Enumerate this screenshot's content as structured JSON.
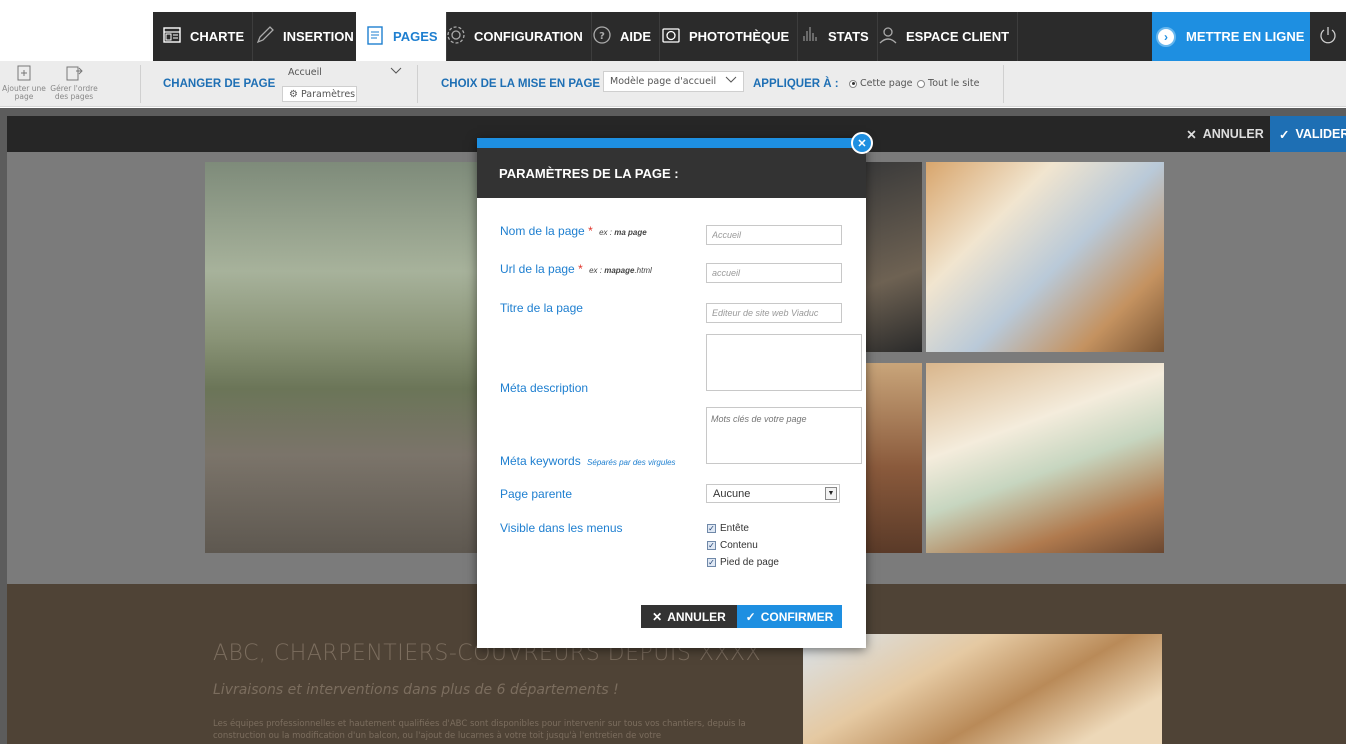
{
  "nav": {
    "items": [
      {
        "label": "CHARTE",
        "icon": "layout-icon"
      },
      {
        "label": "INSERTION",
        "icon": "pencil-icon"
      },
      {
        "label": "PAGES",
        "icon": "pages-icon"
      },
      {
        "label": "CONFIGURATION",
        "icon": "gear-icon"
      },
      {
        "label": "AIDE",
        "icon": "help-icon"
      },
      {
        "label": "PHOTOTHÈQUE",
        "icon": "camera-icon"
      },
      {
        "label": "STATS",
        "icon": "stats-icon"
      },
      {
        "label": "ESPACE CLIENT",
        "icon": "user-icon"
      }
    ],
    "active": "PAGES",
    "publish_label": "METTRE EN LIGNE",
    "accent_color": "#1e8fe1"
  },
  "toolbar": {
    "add_page": "Ajouter une page",
    "order_pages": "Gérer l'ordre des pages",
    "change_page_label": "CHANGER DE PAGE",
    "current_page": "Accueil",
    "params_button": "Paramètres",
    "layout_label": "CHOIX DE LA MISE EN PAGE",
    "layout_value": "Modèle page d'accueil",
    "apply_label": "APPLIQUER À :",
    "apply_options": [
      "Cette page",
      "Tout le site"
    ],
    "apply_selected": "Cette page"
  },
  "editbar": {
    "cancel": "ANNULER",
    "validate": "VALIDER"
  },
  "modal": {
    "title": "PARAMÈTRES DE LA PAGE :",
    "name_label": "Nom de la page",
    "name_hint_prefix": "ex :",
    "name_hint_bold": "ma page",
    "name_placeholder": "Accueil",
    "url_label": "Url de la page",
    "url_hint_prefix": "ex :",
    "url_hint_bold": "mapage",
    "url_hint_suffix": ".html",
    "url_placeholder": "accueil",
    "title_label": "Titre de la page",
    "title_placeholder": "Editeur de site web Viaduc",
    "meta_desc_label": "Méta description",
    "meta_kw_label": "Méta keywords",
    "meta_kw_hint": "Séparés par des virgules",
    "meta_kw_placeholder": "Mots clés de votre page",
    "parent_label": "Page parente",
    "parent_value": "Aucune",
    "visible_label": "Visible dans les menus",
    "visible_options": [
      "Entête",
      "Contenu",
      "Pied de page"
    ],
    "required_mark": "*",
    "cancel": "ANNULER",
    "confirm": "CONFIRMER"
  },
  "site": {
    "heading": "ABC, CHARPENTIERS-COUVREURS DEPUIS XXXX",
    "subheading": "Livraisons et interventions dans plus de 6 départements !",
    "text": "Les équipes professionnelles et hautement qualifiées d'ABC sont disponibles pour intervenir sur tous vos chantiers, depuis la construction ou la modification d'un balcon, ou l'ajout de lucarnes à votre toit jusqu'à l'entretien de votre"
  }
}
